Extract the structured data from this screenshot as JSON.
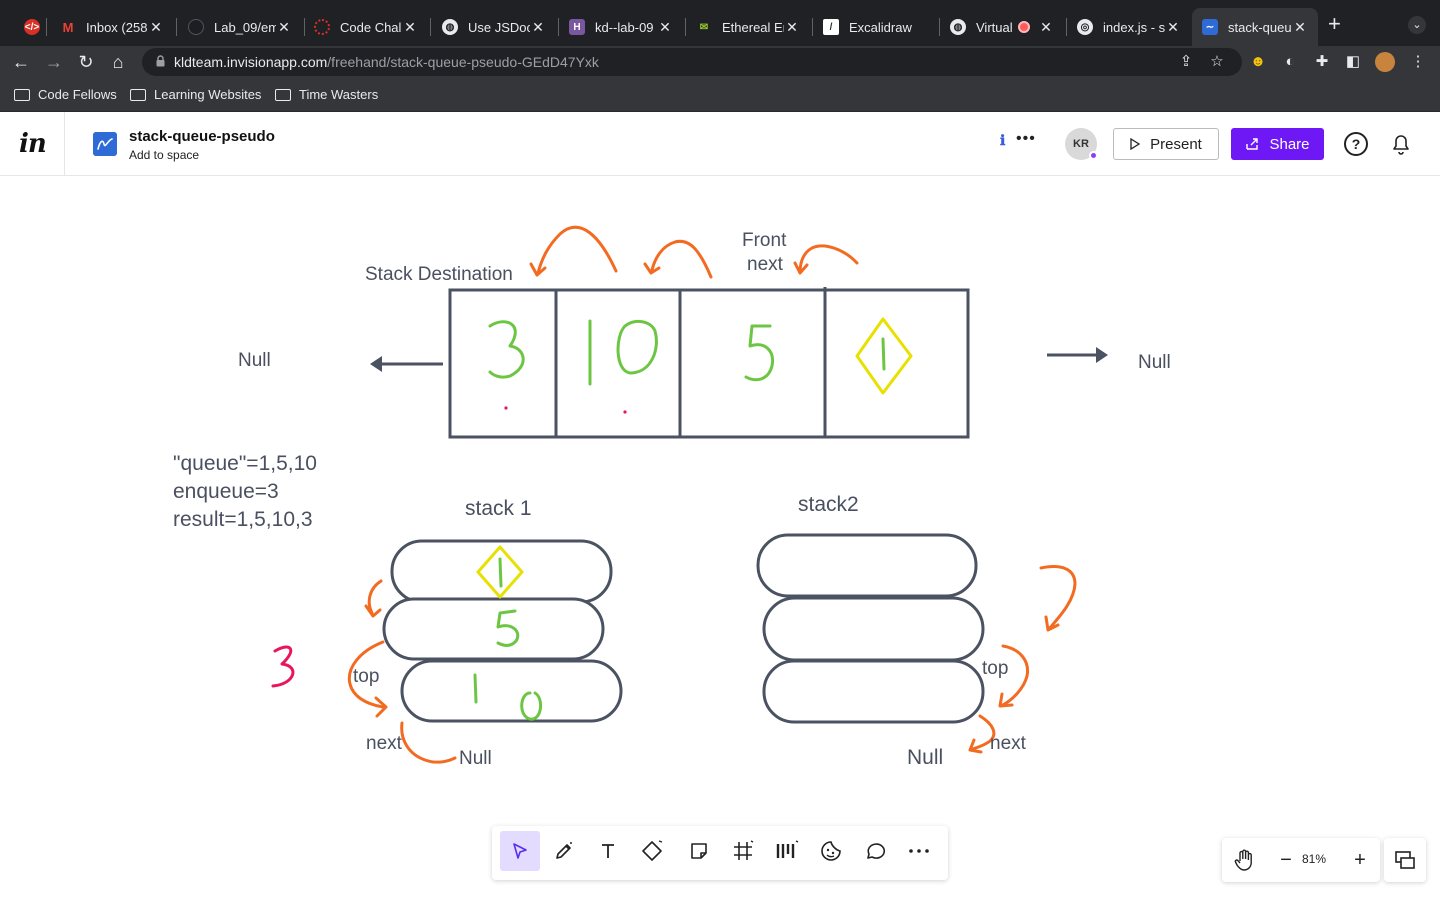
{
  "browser": {
    "tabs": [
      {
        "title": "Inbox (258",
        "active": false
      },
      {
        "title": "Lab_09/em",
        "active": false
      },
      {
        "title": "Code Chall",
        "active": false
      },
      {
        "title": "Use JSDoc",
        "active": false
      },
      {
        "title": "kd--lab-09",
        "active": false
      },
      {
        "title": "Ethereal En",
        "active": false
      },
      {
        "title": "Excalidraw",
        "active": false
      },
      {
        "title": "Virtual",
        "active": false
      },
      {
        "title": "index.js - s",
        "active": false
      },
      {
        "title": "stack-queu",
        "active": true
      }
    ],
    "url_host": "kldteam.invisionapp.com",
    "url_path": "/freehand/stack-queue-pseudo-GEdD47Yxk",
    "bookmarks": [
      "Code Fellows",
      "Learning Websites",
      "Time Wasters"
    ]
  },
  "app": {
    "logo": "in",
    "doc_title": "stack-queue-pseudo",
    "doc_subtitle": "Add to space",
    "avatar_initials": "KR",
    "present_label": "Present",
    "share_label": "Share",
    "help_label": "?",
    "brand_color": "#6d18f5"
  },
  "canvas": {
    "labels": {
      "stack_destination": "Stack Destination",
      "front": "Front",
      "front_next": "next",
      "null_left": "Null",
      "null_right": "Null",
      "queue_line1": "\"queue\"=1,5,10",
      "queue_line2": "enqueue=3",
      "queue_line3": "result=1,5,10,3",
      "stack1": "stack 1",
      "stack2": "stack2",
      "top1": "top",
      "next1": "next",
      "null1": "Null",
      "top2": "top",
      "next2": "next",
      "null2": "Null"
    },
    "queue_cells": [
      "3",
      "10",
      "5",
      "1"
    ],
    "stack1_cells": [
      "1",
      "5",
      "10"
    ],
    "ink_colors": {
      "outline": "#4b5262",
      "green": "#6cc644",
      "yellow": "#e8e000",
      "orange": "#f26b21",
      "pink": "#e8175d"
    }
  },
  "tools": [
    "select",
    "pen",
    "text",
    "shape",
    "sticky-note",
    "frame",
    "layout",
    "sticker",
    "comment",
    "more"
  ],
  "zoom": {
    "level": "81%"
  }
}
